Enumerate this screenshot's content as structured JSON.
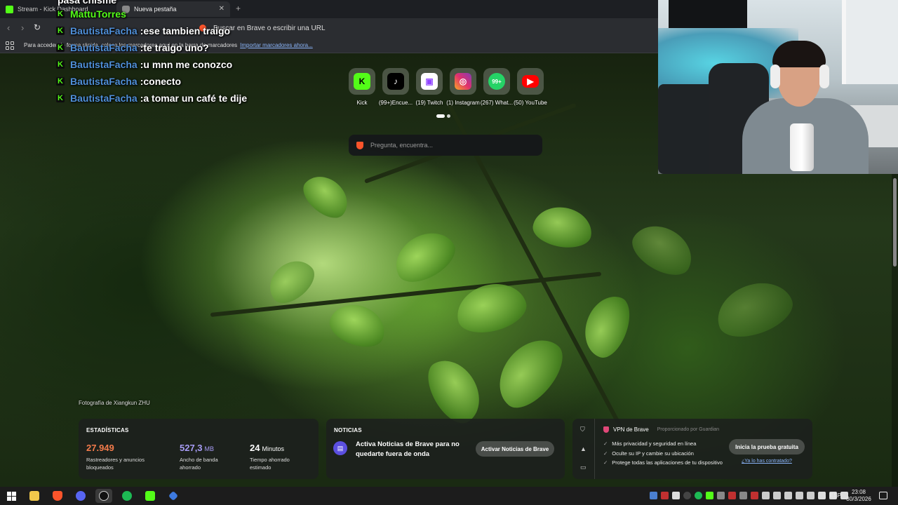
{
  "browser": {
    "tabs": [
      {
        "label": "Stream - Kick Dashboard",
        "active": false
      },
      {
        "label": "Nueva pestaña",
        "active": true
      }
    ],
    "url_placeholder": "Buscar en Brave o escribir una URL",
    "bookmarks_hint": "Para acceder de forma rápida, coloca los marcadores aquí en la barra de marcadores",
    "bookmarks_import": "Importar marcadores ahora..."
  },
  "chat": {
    "messages": [
      {
        "user": "",
        "text": "pasa chisme"
      },
      {
        "user": "MattuTorres",
        "text": ""
      },
      {
        "user": "BautistaFacha",
        "text": "ese tambien traigo"
      },
      {
        "user": "BautistaFacha",
        "text": "te traigo uno?"
      },
      {
        "user": "BautistaFacha",
        "text": "u mnn me conozco"
      },
      {
        "user": "BautistaFacha",
        "text": "conecto"
      },
      {
        "user": "BautistaFacha",
        "text": "a tomar un café te dije"
      }
    ]
  },
  "shortcuts": [
    {
      "label": "Kick",
      "icon": "kick-logo",
      "color": "#53fc18"
    },
    {
      "label": "(99+)Encue...",
      "icon": "tiktok-logo",
      "color": "#000000"
    },
    {
      "label": "(19) Twitch",
      "icon": "twitch-logo",
      "color": "#9146ff"
    },
    {
      "label": "(1) Instagram",
      "icon": "instagram-logo",
      "color": "#e1306c"
    },
    {
      "label": "(267) What...",
      "icon": "whatsapp-logo",
      "color": "#25d366",
      "badge": "99+"
    },
    {
      "label": "(50) YouTube",
      "icon": "youtube-logo",
      "color": "#ff0000"
    }
  ],
  "search": {
    "placeholder": "Pregunta, encuentra..."
  },
  "photo_credit": "Fotografía de Xiangkun ZHU",
  "stats": {
    "title": "ESTADÍSTICAS",
    "trackers": {
      "value": "27.949",
      "label_1": "Rastreadores y anuncios",
      "label_2": "bloqueados",
      "color": "#f37b4b"
    },
    "bandwidth": {
      "value": "527,3",
      "unit": "MB",
      "label_1": "Ancho de banda",
      "label_2": "ahorrado",
      "color": "#a79cf5"
    },
    "time": {
      "value": "24",
      "unit": "Minutos",
      "label_1": "Tiempo ahorrado",
      "label_2": "estimado",
      "color": "#ffffff"
    }
  },
  "news": {
    "title": "NOTICIAS",
    "text": "Activa Noticias de Brave para no quedarte fuera de onda",
    "button": "Activar Noticias de Brave"
  },
  "vpn": {
    "title": "VPN de Brave",
    "provided_by": "Proporcionado por  Guardian",
    "features": [
      "Más privacidad y seguridad en línea",
      "Oculte su IP y cambie su ubicación",
      "Protege todas las aplicaciones de tu dispositivo"
    ],
    "button": "Inicia la prueba gratuita",
    "link": "¿Ya lo has contratado?"
  },
  "taskbar": {
    "language": "ESP",
    "time": "23:08",
    "date": "30/3/2026"
  }
}
